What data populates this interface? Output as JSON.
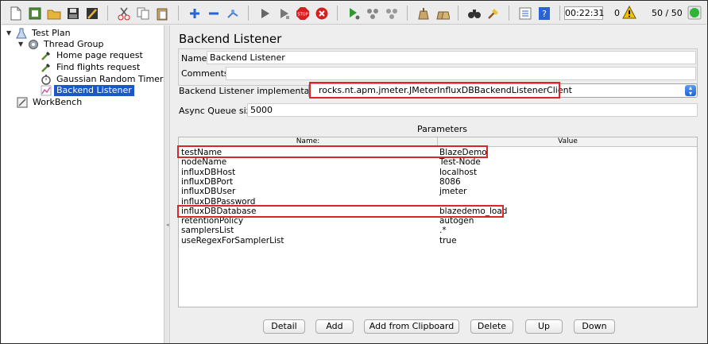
{
  "toolbar": {
    "timer": "00:22:31",
    "warning_count": "0",
    "thread_count": "50 / 50",
    "colors": {
      "run": "#2f9a2f",
      "stop": "#d52020",
      "indicator": "#2fb43a"
    }
  },
  "tree": {
    "nodes": [
      {
        "label": "Test Plan",
        "icon": "flask-icon"
      },
      {
        "label": "Thread Group",
        "icon": "gear-icon"
      },
      {
        "label": "Home page request",
        "icon": "pipette-icon"
      },
      {
        "label": "Find flights request",
        "icon": "pipette-icon"
      },
      {
        "label": "Gaussian Random Timer",
        "icon": "stopwatch-icon"
      },
      {
        "label": "Backend Listener",
        "icon": "chart-icon"
      },
      {
        "label": "WorkBench",
        "icon": "workbench-icon"
      }
    ]
  },
  "panel": {
    "title": "Backend Listener",
    "name_label": "Name:",
    "name_value": "Backend Listener",
    "comments_label": "Comments:",
    "impl_label": "Backend Listener implementation",
    "impl_value": "rocks.nt.apm.jmeter.JMeterInfluxDBBackendListenerClient",
    "queue_label": "Async Queue size",
    "queue_value": "5000",
    "params_title": "Parameters",
    "col_name": "Name:",
    "col_value": "Value",
    "params": [
      {
        "name": "testName",
        "value": "BlazeDemo"
      },
      {
        "name": "nodeName",
        "value": "Test-Node"
      },
      {
        "name": "influxDBHost",
        "value": "localhost"
      },
      {
        "name": "influxDBPort",
        "value": "8086"
      },
      {
        "name": "influxDBUser",
        "value": "jmeter"
      },
      {
        "name": "influxDBPassword",
        "value": ""
      },
      {
        "name": "influxDBDatabase",
        "value": "blazedemo_load"
      },
      {
        "name": "retentionPolicy",
        "value": "autogen"
      },
      {
        "name": "samplersList",
        "value": ".*"
      },
      {
        "name": "useRegexForSamplerList",
        "value": "true"
      }
    ],
    "buttons": {
      "detail": "Detail",
      "add": "Add",
      "add_clipboard": "Add from Clipboard",
      "delete": "Delete",
      "up": "Up",
      "down": "Down"
    },
    "highlight_color": "#d9262a",
    "selection_color": "#1c56c9"
  }
}
